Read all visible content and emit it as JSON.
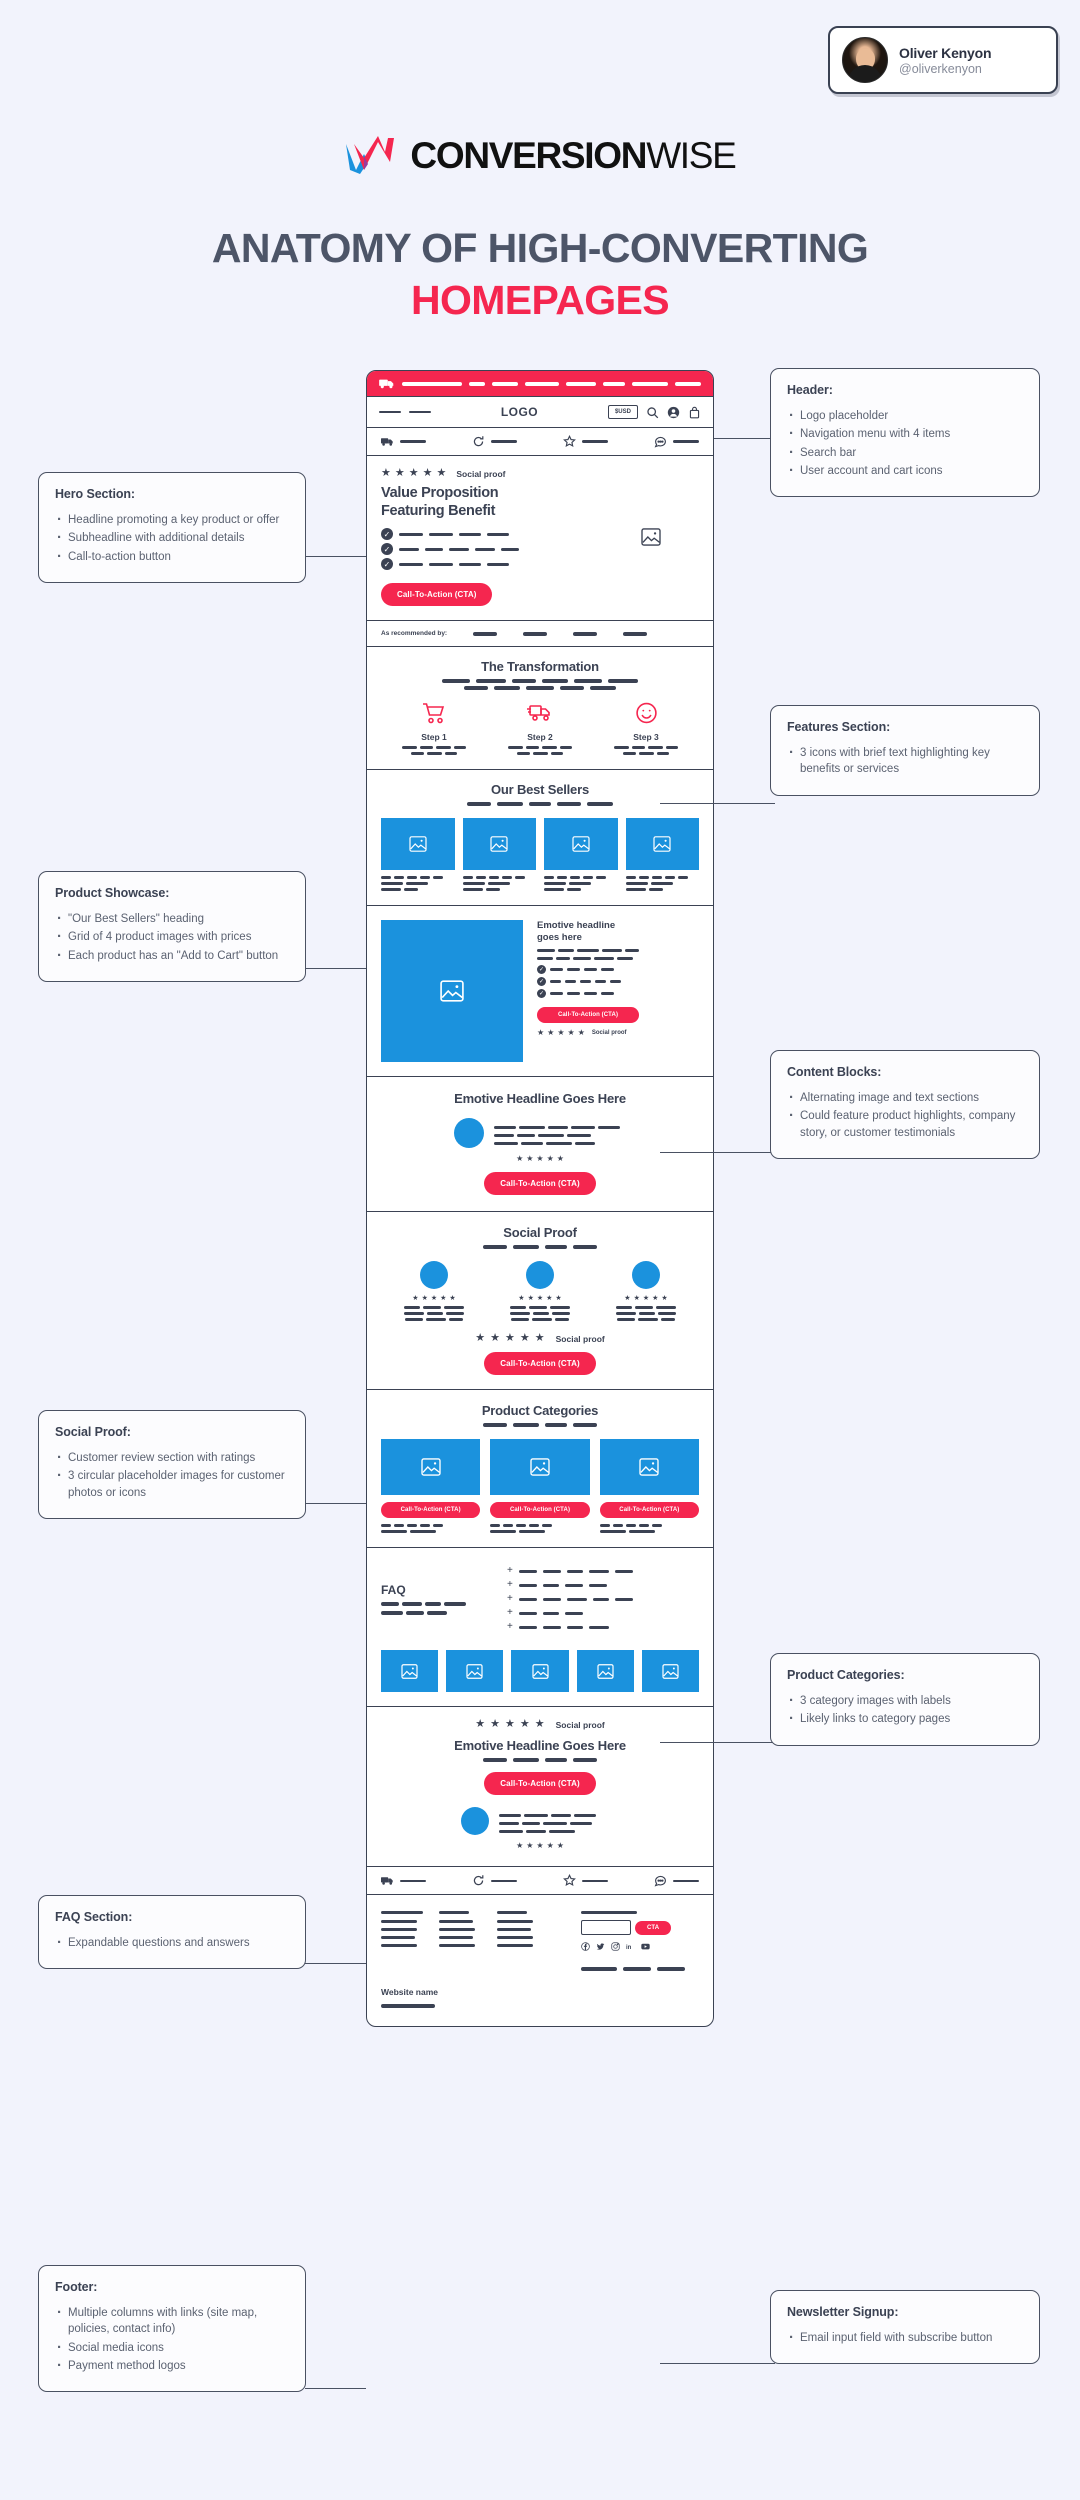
{
  "author": {
    "name": "Oliver Kenyon",
    "handle": "@oliverkenyon",
    "avatar_icon": "user-photo"
  },
  "brand": {
    "bold": "CONVERSION",
    "light": "WISE",
    "mark_icon": "w-logo-mark",
    "colors": {
      "pink": "#f5264f",
      "blue": "#1b92dd"
    }
  },
  "title": {
    "line1": "ANATOMY OF HIGH-CONVERTING",
    "line2": "HOMEPAGES",
    "line1_color": "#4d5568",
    "line2_color": "#f5264f"
  },
  "callouts": [
    {
      "id": "header",
      "heading": "Header:",
      "items": [
        "Logo placeholder",
        "Navigation menu with 4 items",
        "Search bar",
        "User account and cart icons"
      ]
    },
    {
      "id": "hero",
      "heading": "Hero Section:",
      "items": [
        "Headline promoting a key product or offer",
        "Subheadline with additional details",
        "Call-to-action button"
      ]
    },
    {
      "id": "features",
      "heading": "Features Section:",
      "items": [
        "3 icons with brief text highlighting key benefits or services"
      ]
    },
    {
      "id": "product-showcase",
      "heading": "Product Showcase:",
      "items": [
        "\"Our Best Sellers\" heading",
        "Grid of 4 product images with prices",
        "Each product has an \"Add to Cart\" button"
      ]
    },
    {
      "id": "content-blocks",
      "heading": "Content Blocks:",
      "items": [
        "Alternating image and text sections",
        "Could feature product highlights, company story, or customer testimonials"
      ]
    },
    {
      "id": "social-proof",
      "heading": "Social Proof:",
      "items": [
        "Customer review section with ratings",
        "3 circular placeholder images for customer photos or icons"
      ]
    },
    {
      "id": "product-categories",
      "heading": "Product Categories:",
      "items": [
        "3 category images with labels",
        "Likely links to category pages"
      ]
    },
    {
      "id": "faq",
      "heading": "FAQ Section:",
      "items": [
        "Expandable questions and answers"
      ]
    },
    {
      "id": "footer",
      "heading": "Footer:",
      "items": [
        "Multiple columns with links (site map, policies, contact info)",
        "Social media icons",
        "Payment method logos"
      ]
    },
    {
      "id": "newsletter",
      "heading": "Newsletter Signup:",
      "items": [
        "Email input field with subscribe button"
      ]
    }
  ],
  "mockup": {
    "announcement": {
      "icon": "truck-icon"
    },
    "nav": {
      "logo": "LOGO",
      "currency": "$USD",
      "icons": [
        "search-icon",
        "user-icon",
        "cart-icon"
      ]
    },
    "usp_icons": [
      "truck-icon",
      "refresh-icon",
      "star-icon",
      "chat-icon"
    ],
    "hero": {
      "social_proof": "Social proof",
      "headline_line1": "Value Proposition",
      "headline_line2": "Featuring Benefit",
      "cta": "Call-To-Action (CTA)",
      "image_icon": "image-placeholder-icon"
    },
    "recommended": {
      "label": "As recommended by:"
    },
    "transformation": {
      "heading": "The Transformation",
      "steps": [
        {
          "label": "Step 1",
          "icon": "shopping-cart-icon"
        },
        {
          "label": "Step 2",
          "icon": "delivery-truck-icon"
        },
        {
          "label": "Step 3",
          "icon": "smiley-face-icon"
        }
      ]
    },
    "best_sellers": {
      "heading": "Our Best Sellers",
      "product_count": 4
    },
    "content_block": {
      "headline_line1": "Emotive headline",
      "headline_line2": "goes here",
      "cta": "Call-To-Action (CTA)",
      "social_proof": "Social proof"
    },
    "emotive_block": {
      "heading": "Emotive Headline Goes Here",
      "cta": "Call-To-Action (CTA)"
    },
    "social_proof_block": {
      "heading": "Social Proof",
      "cta": "Call-To-Action (CTA)",
      "avatar_count": 3
    },
    "categories": {
      "heading": "Product Categories",
      "cta": "Call-To-Action (CTA)",
      "count": 3
    },
    "faq": {
      "heading": "FAQ",
      "row_count": 5,
      "expand_icon": "plus-icon",
      "thumb_count": 5
    },
    "final_cta": {
      "heading": "Emotive Headline Goes Here",
      "cta": "Call-To-Action (CTA)",
      "social_proof": "Social proof"
    },
    "footer": {
      "usp_icons": [
        "truck-icon",
        "refresh-icon",
        "star-icon",
        "chat-icon"
      ],
      "newsletter_cta": "CTA",
      "social_icons": [
        "facebook-icon",
        "twitter-icon",
        "instagram-icon",
        "linkedin-icon",
        "youtube-icon"
      ],
      "site_name": "Website name",
      "column_count": 3
    }
  }
}
